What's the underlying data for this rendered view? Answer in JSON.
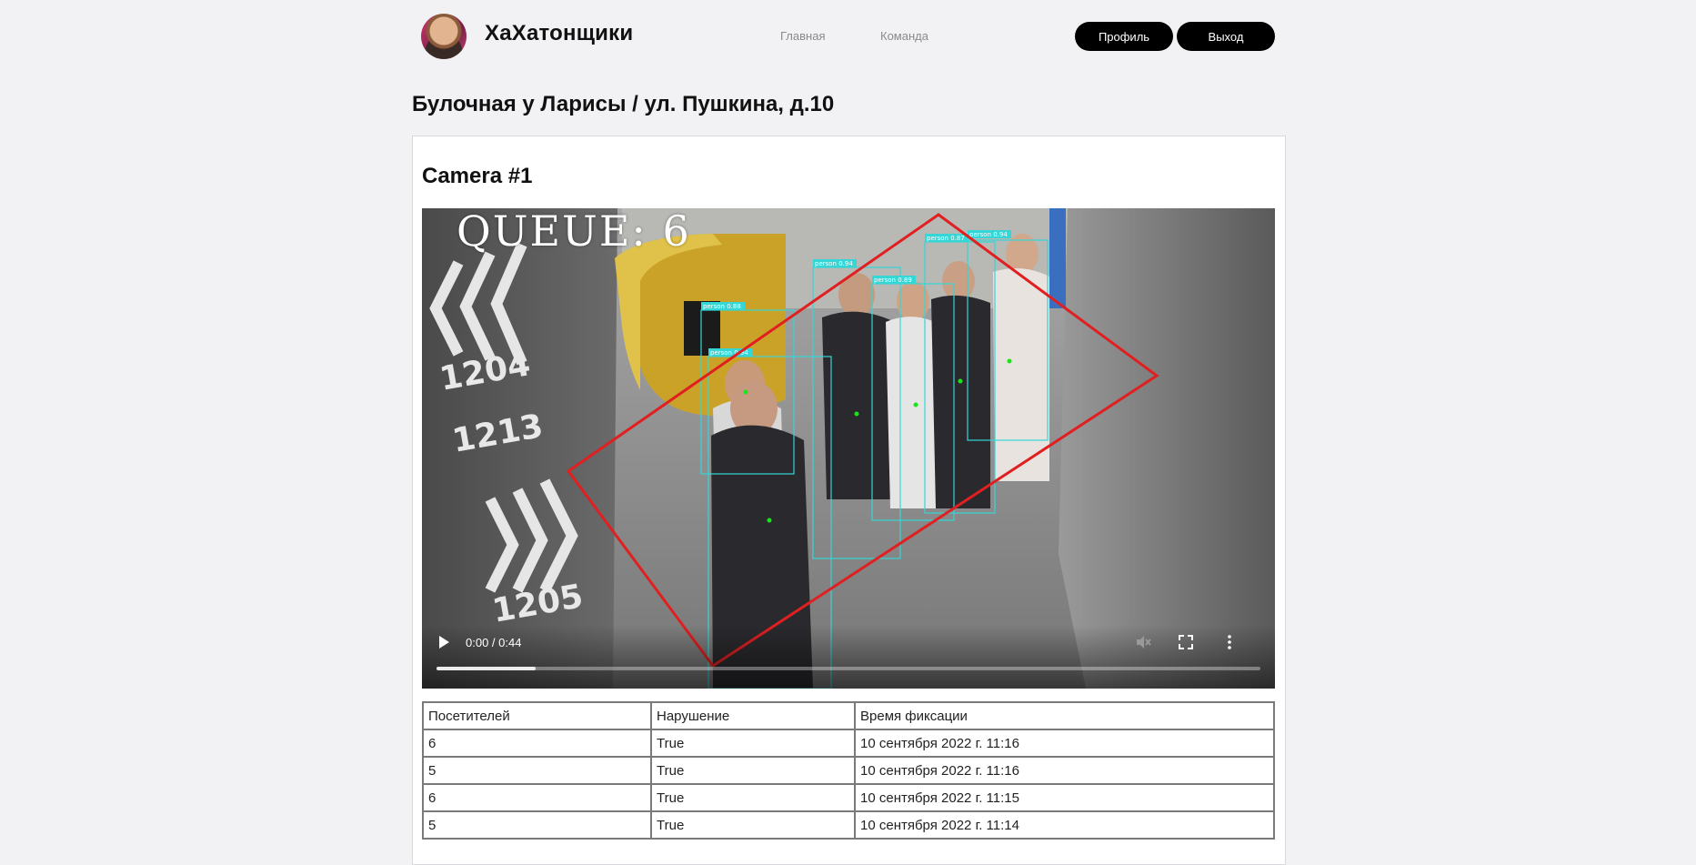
{
  "header": {
    "brand": "ХаХатонщики",
    "nav": [
      {
        "label": "Главная"
      },
      {
        "label": "Команда"
      }
    ],
    "buttons": {
      "profile": "Профиль",
      "logout": "Выход"
    }
  },
  "page": {
    "title": "Булочная у Ларисы / ул. Пушкина, д.10"
  },
  "camera": {
    "title": "Camera #1",
    "video": {
      "overlay_text": "QUEUE: 6",
      "time": "0:00 / 0:44",
      "progress_fraction": 0.12,
      "wall_signs": [
        "1204",
        "1213",
        "1205"
      ],
      "detections": [
        "person 0.88",
        "person 0.94",
        "person 0.94",
        "person 0.89",
        "person 0.87",
        "person 0.94"
      ]
    },
    "table": {
      "headers": [
        "Посетителей",
        "Нарушение",
        "Время фиксации"
      ],
      "rows": [
        [
          "6",
          "True",
          "10 сентября 2022 г. 11:16"
        ],
        [
          "5",
          "True",
          "10 сентября 2022 г. 11:16"
        ],
        [
          "6",
          "True",
          "10 сентября 2022 г. 11:15"
        ],
        [
          "5",
          "True",
          "10 сентября 2022 г. 11:14"
        ]
      ]
    }
  },
  "colors": {
    "page_bg": "#f2f2f4",
    "button_bg": "#000000",
    "nav_text": "#8a8a8f",
    "zone_outline": "#e02020",
    "detection_box": "#35d6d6"
  }
}
